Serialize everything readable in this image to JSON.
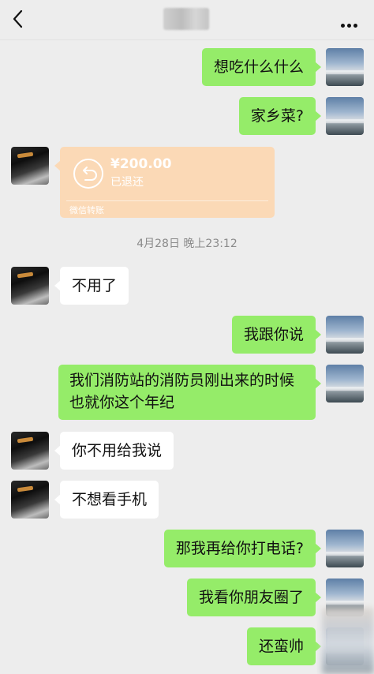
{
  "header": {
    "back_icon": "chevron-left-icon",
    "more_icon": "more-dots-icon"
  },
  "colors": {
    "background": "#ededed",
    "bubble_self": "#95ec69",
    "bubble_other": "#ffffff",
    "transfer_card": "#fbd9b6"
  },
  "messages": [
    {
      "side": "right",
      "text": "想吃什么什么"
    },
    {
      "side": "right",
      "text": "家乡菜?"
    },
    {
      "side": "left",
      "type": "transfer",
      "amount": "¥200.00",
      "status": "已退还",
      "footer": "微信转账"
    },
    {
      "type": "timestamp",
      "text": "4月28日 晚上23:12"
    },
    {
      "side": "left",
      "text": "不用了"
    },
    {
      "side": "right",
      "text": "我跟你说"
    },
    {
      "side": "right",
      "text": "我们消防站的消防员刚出来的时候也就你这个年纪"
    },
    {
      "side": "left",
      "text": "你不用给我说"
    },
    {
      "side": "left",
      "text": "不想看手机"
    },
    {
      "side": "right",
      "text": "那我再给你打电话?"
    },
    {
      "side": "right",
      "text": "我看你朋友圈了"
    },
    {
      "side": "right",
      "text": "还蛮帅"
    }
  ]
}
